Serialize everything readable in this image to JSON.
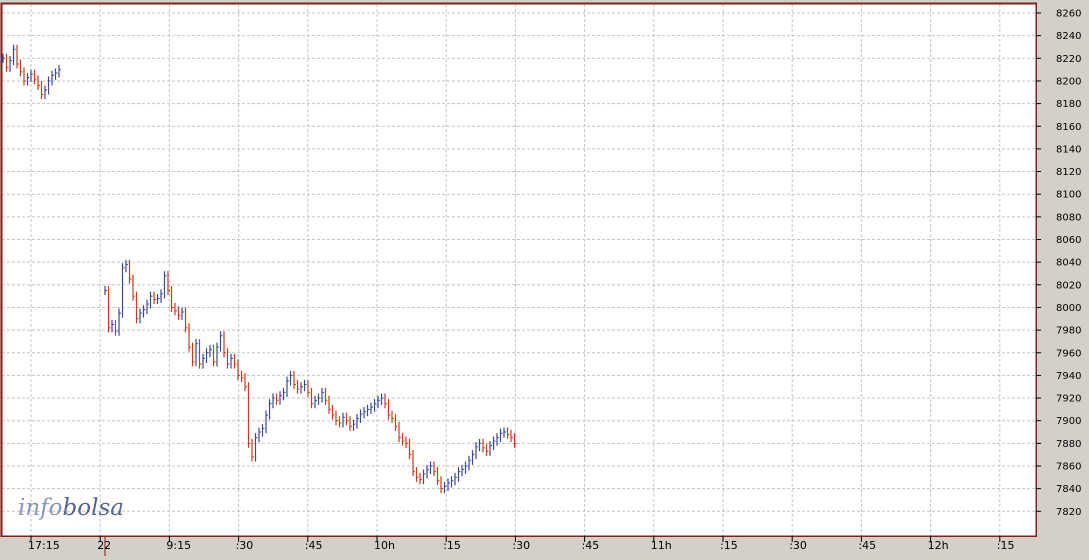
{
  "logo": {
    "part1": "info",
    "part2": "bolsa"
  },
  "colors": {
    "background": "#ffffff",
    "frame": "#7f1f1f",
    "grid": "#c4c4c4",
    "up": "#3a4a8c",
    "down": "#c0401e",
    "axis_bg": "#d4d0c8",
    "axis_text": "#000000"
  },
  "chart_data": {
    "type": "ohlc",
    "title": "",
    "xlabel": "",
    "ylabel": "",
    "ylim": [
      7800,
      8270
    ],
    "y_ticks": [
      8260,
      8240,
      8220,
      8200,
      8180,
      8160,
      8140,
      8120,
      8100,
      8080,
      8060,
      8040,
      8020,
      8000,
      7980,
      7960,
      7940,
      7920,
      7900,
      7880,
      7860,
      7840,
      7820
    ],
    "x_tick_labels": [
      "17:15",
      "22",
      "9:15",
      ":30",
      ":45",
      "10h",
      ":15",
      ":30",
      ":45",
      "11h",
      ":15",
      ":30",
      ":45",
      "12h",
      ":15"
    ],
    "grid": true,
    "series": [
      {
        "values": [
          8220,
          8212,
          8218,
          8228,
          8215,
          8208,
          8200,
          8203,
          8206,
          8201,
          8196,
          8188,
          8192,
          8200,
          8205,
          8207,
          8210
        ]
      },
      {
        "values": [
          8015,
          7982,
          7985,
          7979,
          7995,
          8035,
          8038,
          8025,
          8010,
          7990,
          7995,
          7998,
          8003,
          8010,
          8007,
          8008,
          8012,
          8028,
          8015,
          8000,
          7997,
          7993,
          7996,
          7982,
          7965,
          7952,
          7968,
          7950,
          7955,
          7960,
          7963,
          7952,
          7965,
          7975,
          7960,
          7950,
          7955,
          7950,
          7940,
          7938,
          7930,
          7880,
          7868,
          7885,
          7890,
          7893,
          7905,
          7915,
          7920,
          7918,
          7922,
          7925,
          7935,
          7940,
          7932,
          7928,
          7930,
          7932,
          7925,
          7915,
          7918,
          7920,
          7925,
          7918,
          7910,
          7905,
          7900,
          7898,
          7903,
          7900,
          7895,
          7897,
          7902,
          7906,
          7908,
          7910,
          7912,
          7915,
          7918,
          7920,
          7915,
          7905,
          7902,
          7895,
          7885,
          7882,
          7880,
          7870,
          7855,
          7850,
          7848,
          7853,
          7857,
          7860,
          7855,
          7847,
          7840,
          7842,
          7845,
          7847,
          7850,
          7855,
          7857,
          7860,
          7865,
          7870,
          7877,
          7880,
          7876,
          7873,
          7878,
          7882,
          7885,
          7889,
          7890,
          7888,
          7885,
          7880
        ]
      }
    ]
  }
}
